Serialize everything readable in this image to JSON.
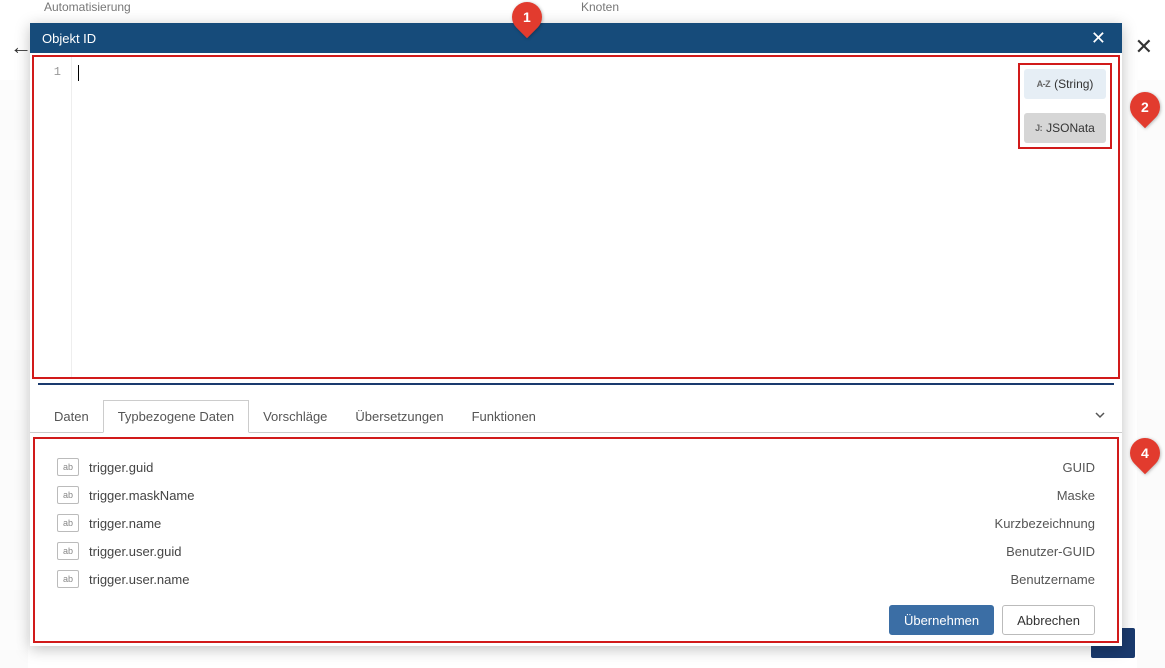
{
  "bg": {
    "tab_left": "Automatisierung",
    "tab_right": "Knoten"
  },
  "modal": {
    "title": "Objekt ID",
    "editor": {
      "line_number": "1",
      "content": ""
    },
    "type_buttons": {
      "string_icon": "A-Z",
      "string_label": "(String)",
      "jsonata_icon": "J:",
      "jsonata_label": "JSONata"
    },
    "tabs": [
      {
        "label": "Daten"
      },
      {
        "label": "Typbezogene Daten"
      },
      {
        "label": "Vorschläge"
      },
      {
        "label": "Übersetzungen"
      },
      {
        "label": "Funktionen"
      }
    ],
    "active_tab_index": 1,
    "data_rows": [
      {
        "icon": "ab",
        "key": "trigger.guid",
        "label": "GUID"
      },
      {
        "icon": "ab",
        "key": "trigger.maskName",
        "label": "Maske"
      },
      {
        "icon": "ab",
        "key": "trigger.name",
        "label": "Kurzbezeichnung"
      },
      {
        "icon": "ab",
        "key": "trigger.user.guid",
        "label": "Benutzer-GUID"
      },
      {
        "icon": "ab",
        "key": "trigger.user.name",
        "label": "Benutzername"
      }
    ],
    "footer": {
      "apply": "Übernehmen",
      "cancel": "Abbrechen"
    }
  },
  "markers": {
    "m1": "1",
    "m2": "2",
    "m4": "4"
  }
}
